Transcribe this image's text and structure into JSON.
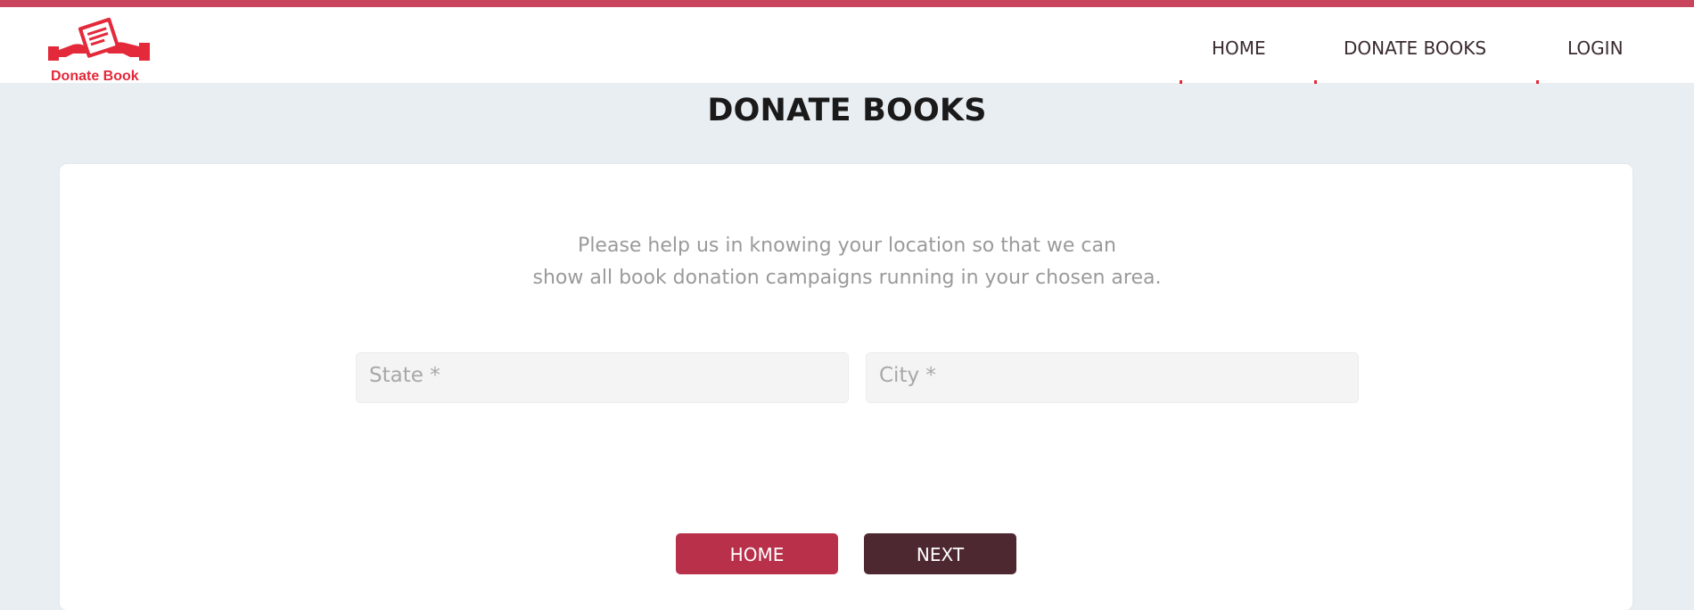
{
  "brand": {
    "name": "Donate Book",
    "color": "#e3293a"
  },
  "nav": {
    "items": [
      {
        "label": "HOME"
      },
      {
        "label": "DONATE BOOKS"
      },
      {
        "label": "LOGIN"
      }
    ]
  },
  "page": {
    "title": "DONATE BOOKS",
    "intro_line1": "Please help us in knowing your location so that we can",
    "intro_line2": "show all book donation campaigns running in your chosen area."
  },
  "form": {
    "state_placeholder": "State *",
    "state_value": "",
    "city_placeholder": "City *",
    "city_value": ""
  },
  "actions": {
    "home_label": "HOME",
    "next_label": "NEXT"
  },
  "colors": {
    "accent": "#c8455d",
    "home_button": "#b8304a",
    "next_button": "#4e2831",
    "background": "#e9eef2"
  }
}
